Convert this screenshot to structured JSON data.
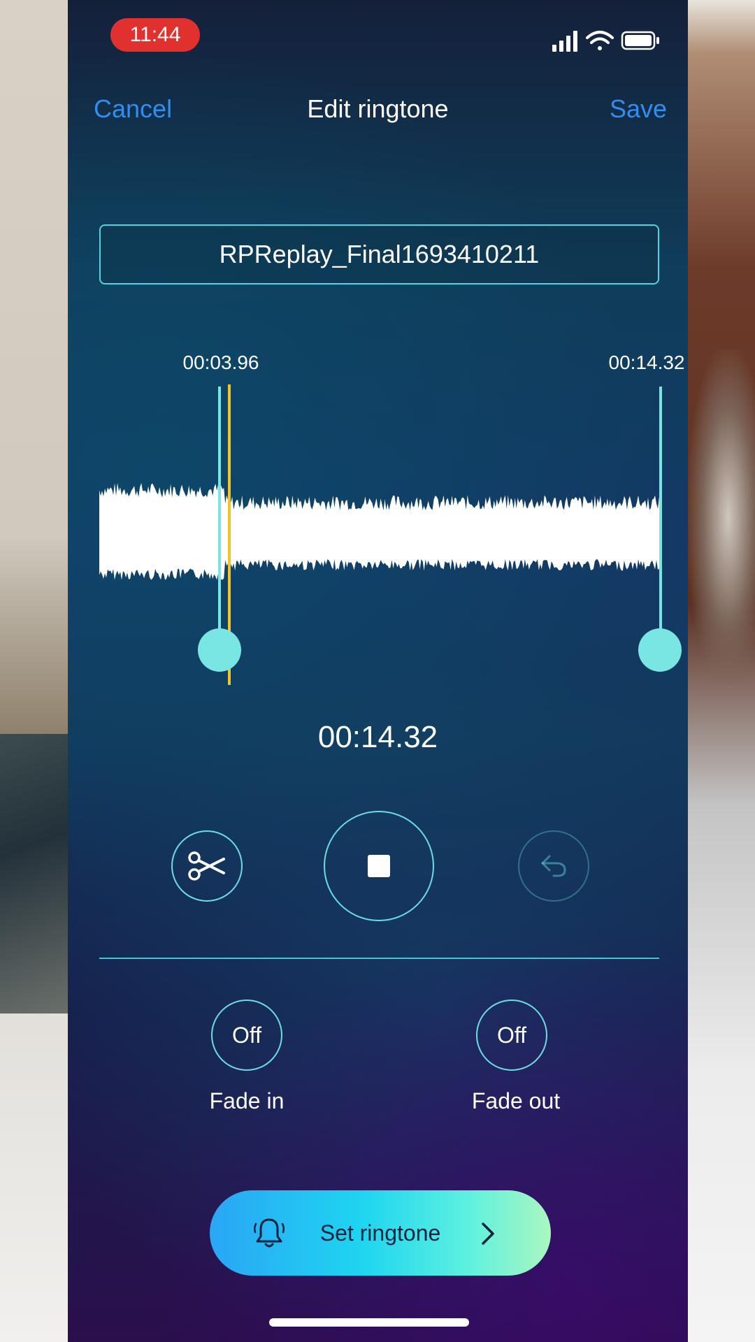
{
  "status_bar": {
    "time": "11:44",
    "icons": [
      "signal-icon",
      "wifi-icon",
      "battery-icon"
    ]
  },
  "nav": {
    "cancel_label": "Cancel",
    "title": "Edit ringtone",
    "save_label": "Save"
  },
  "file_name": "RPReplay_Final1693410211",
  "trim": {
    "start_time": "00:03.96",
    "end_time": "00:14.32"
  },
  "current_time": "00:14.32",
  "controls": {
    "icons": [
      "scissors-icon",
      "stop-icon",
      "undo-icon"
    ]
  },
  "fade": {
    "fade_in_value": "Off",
    "fade_in_label": "Fade in",
    "fade_out_value": "Off",
    "fade_out_label": "Fade out"
  },
  "set_ringtone": {
    "label": "Set ringtone",
    "icons": [
      "bell-icon",
      "chevron-right-icon"
    ]
  },
  "colors": {
    "accent_blue": "#2f8ff0",
    "handle_cyan": "#7ae6e4",
    "playhead_yellow": "#f2c524",
    "time_pill_red": "#e0312f"
  }
}
